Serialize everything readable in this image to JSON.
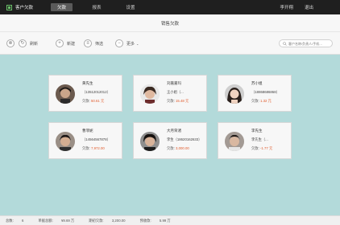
{
  "app": {
    "name": "客户欠款",
    "icon": "grid-logo-icon"
  },
  "nav": {
    "tabs": [
      "欠款",
      "报表",
      "设置"
    ],
    "active": 0
  },
  "top_links": [
    "李开翔",
    "退出"
  ],
  "page_title": "销售欠款",
  "toolbar": {
    "refresh_label": "刷新",
    "add_label": "新建",
    "filter_label": "筛选",
    "more_label": "更多",
    "search_placeholder": "客户名称/负责人/手机…"
  },
  "amount_label": "欠款:",
  "customers": [
    {
      "name": "黄先生",
      "phone": "（13512012012）",
      "amount": "50.61 元"
    },
    {
      "name": "刘嘉嘉玛",
      "phone": "王小姐（...",
      "amount": "15.48 元"
    },
    {
      "name": "苏小姐",
      "phone": "（18868686868）",
      "amount": "1.32 元"
    },
    {
      "name": "曹菲妮",
      "phone": "（14564567878）",
      "amount": "7,972.00"
    },
    {
      "name": "大月荣渚",
      "phone": "李生（18620162633）",
      "amount": "3,000.00"
    },
    {
      "name": "李先生",
      "phone": "李先生（...",
      "amount": "-1.77 元"
    }
  ],
  "footer": {
    "total_label": "总数:",
    "total_value": "6",
    "sales_label": "单据总额:",
    "sales_value": "¥9.69 万",
    "debt_label": "期初欠款:",
    "debt_value": "3,200.00",
    "receive_label": "预收款:",
    "receive_value": "5.99 万"
  },
  "colors": {
    "accent": "#e05a2b",
    "background": "#b3dada",
    "topbar": "#1f1f1f"
  }
}
